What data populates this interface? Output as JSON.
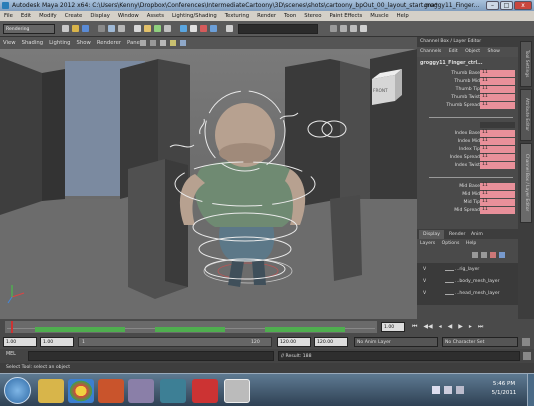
{
  "window": {
    "title": "Autodesk Maya 2012 x64: C:\\Users\\Kenny\\Dropbox\\Conferences\\IntermediateCartoony\\3D\\scenes\\shots\\cartoony_bpOut_00_layout_start.ma*",
    "title_right": "groggy11_Finger...",
    "min": "–",
    "max": "□",
    "close": "x"
  },
  "menu": [
    "File",
    "Edit",
    "Modify",
    "Create",
    "Display",
    "Window",
    "Assets",
    "Lighting/Shading",
    "Texturing",
    "Render",
    "Toon",
    "Stereo",
    "Paint Effects",
    "Muscle",
    "Help"
  ],
  "shelf": {
    "mode": "Rendering"
  },
  "panel_menu": [
    "View",
    "Shading",
    "Lighting",
    "Show",
    "Renderer",
    "Panels"
  ],
  "viewcube": {
    "label": "FRONT"
  },
  "channel_box": {
    "title": "Channel Box / Layer Editor",
    "menu": [
      "Channels",
      "Edit",
      "Object",
      "Show"
    ],
    "object_name": "groggy11_Finger_ctrl...",
    "groups": [
      [
        {
          "name": "Thumb Base",
          "value": "11"
        },
        {
          "name": "Thumb Mid",
          "value": "11"
        },
        {
          "name": "Thumb Tip",
          "value": "11"
        },
        {
          "name": "Thumb Twist",
          "value": "11"
        },
        {
          "name": "Thumb Spread",
          "value": "11"
        }
      ],
      [
        {
          "name": "Index Base",
          "value": "11"
        },
        {
          "name": "Index Mid",
          "value": "11"
        },
        {
          "name": "Index Tip",
          "value": "11"
        },
        {
          "name": "Index Spread",
          "value": "11"
        },
        {
          "name": "Index Twist",
          "value": "11"
        }
      ],
      [
        {
          "name": "Mid Base",
          "value": "11"
        },
        {
          "name": "Mid Mid",
          "value": "11"
        },
        {
          "name": "Mid Tip",
          "value": "11"
        },
        {
          "name": "Mid Spread",
          "value": "11"
        }
      ]
    ]
  },
  "layer_editor": {
    "tabs": [
      "Display",
      "Render",
      "Anim"
    ],
    "menu": [
      "Layers",
      "Options",
      "Help"
    ],
    "layers": [
      {
        "visible": "V",
        "name": "...rig_layer"
      },
      {
        "visible": "V",
        "name": "...body_mesh_layer"
      },
      {
        "visible": "V",
        "name": "...head_mesh_layer"
      }
    ]
  },
  "side_tabs": [
    "Tool Settings",
    "Attribute Editor",
    "Channel Box / Layer Editor"
  ],
  "time_slider": {
    "current_frame": "1.00"
  },
  "range_slider": {
    "start": "1.00",
    "playback_start": "1.00",
    "range_label": "1",
    "range_end_label": "120",
    "playback_end": "120.00",
    "end": "120.00",
    "anim_layer": "No Anim Layer",
    "character_set": "No Character Set"
  },
  "command_line": {
    "lang": "MEL",
    "result": "// Result: 188"
  },
  "help_line": "Select Tool: select an object",
  "taskbar": {
    "time": "5:46 PM",
    "date": "5/1/2011"
  }
}
